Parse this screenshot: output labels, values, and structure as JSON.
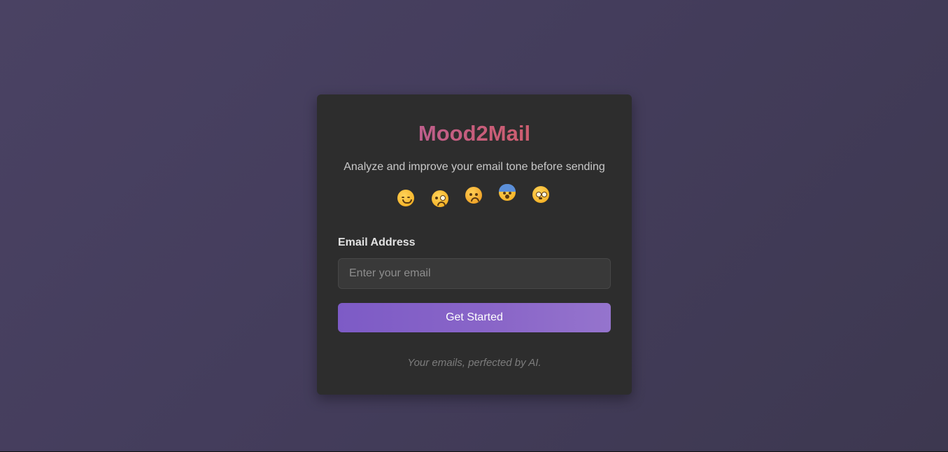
{
  "app": {
    "title": "Mood2Mail",
    "subtitle": "Analyze and improve your email tone before sending"
  },
  "emojis": [
    {
      "name": "smiling-face-icon"
    },
    {
      "name": "face-with-monocle-icon"
    },
    {
      "name": "angry-face-icon"
    },
    {
      "name": "fearful-face-icon"
    },
    {
      "name": "flushed-face-icon"
    }
  ],
  "form": {
    "email_label": "Email Address",
    "email_placeholder": "Enter your email",
    "email_value": "",
    "submit_label": "Get Started"
  },
  "footer": {
    "tagline": "Your emails, perfected by AI."
  },
  "colors": {
    "accent": "#8a66c8",
    "title_gradient_start": "#b15fa3",
    "title_gradient_end": "#d4605f",
    "card_background": "#2d2d2d"
  }
}
